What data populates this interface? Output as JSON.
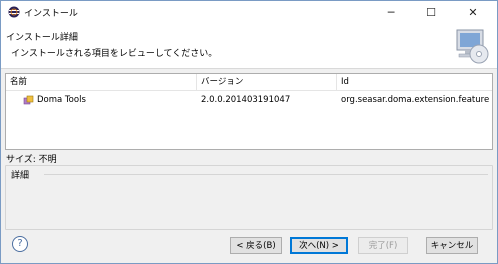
{
  "window": {
    "title": "インストール"
  },
  "controls": {
    "minimize": "─",
    "maximize": "☐",
    "close": "✕"
  },
  "header": {
    "title": "インストール詳細",
    "description": "インストールされる項目をレビューしてください。"
  },
  "table": {
    "columns": [
      "名前",
      "バージョン",
      "Id"
    ],
    "rows": [
      {
        "name": "Doma Tools",
        "version": "2.0.0.201403191047",
        "id": "org.seasar.doma.extension.feature...."
      }
    ]
  },
  "size": {
    "label": "サイズ: 不明"
  },
  "details": {
    "label": "詳細"
  },
  "buttons": {
    "back": "< 戻る(B)",
    "next": "次へ(N) >",
    "finish": "完了(F)",
    "cancel": "キャンセル"
  },
  "icons": {
    "app": "eclipse-icon",
    "banner": "install-computer-icon",
    "item": "plugin-feature-icon",
    "help": "help-icon"
  }
}
